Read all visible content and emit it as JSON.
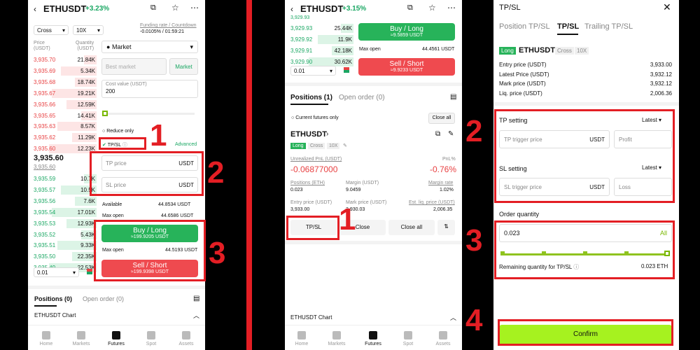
{
  "panel1": {
    "pair": "ETHUSDT",
    "change": "+3.23%",
    "margin_mode": "Cross",
    "leverage": "10X",
    "funding_label": "Funding rate / Countdown",
    "funding_value": "-0.0105% / 01:59:21",
    "col_price": "Price\n(USDT)",
    "col_qty": "Quantity\n(USDT)",
    "asks": [
      [
        "3,935.70",
        "21.84K"
      ],
      [
        "3,935.69",
        "5.34K"
      ],
      [
        "3,935.68",
        "18.74K"
      ],
      [
        "3,935.67",
        "19.21K"
      ],
      [
        "3,935.66",
        "12.59K"
      ],
      [
        "3,935.65",
        "14.41K"
      ],
      [
        "3,935.63",
        "8.57K"
      ],
      [
        "3,935.62",
        "11.29K"
      ],
      [
        "3,935.60",
        "12.23K"
      ]
    ],
    "last_price": "3,935.60",
    "mark_price": "3,935.60",
    "bids": [
      [
        "3,935.59",
        "10.7K"
      ],
      [
        "3,935.57",
        "10.5K"
      ],
      [
        "3,935.56",
        "7.6K"
      ],
      [
        "3,935.54",
        "17.01K"
      ],
      [
        "3,935.53",
        "12.93K"
      ],
      [
        "3,935.52",
        "5.43K"
      ],
      [
        "3,935.51",
        "9.33K"
      ],
      [
        "3,935.50",
        "22.35K"
      ],
      [
        "3,935.49",
        "22.53K"
      ]
    ],
    "precision": "0.01",
    "order_type": "Market",
    "best_market_placeholder": "Best market",
    "market_btn": "Market",
    "cost_label": "Cost value (USDT)",
    "cost_value": "200",
    "reduce_only": "Reduce only",
    "tpsl": "TP/SL",
    "advanced": "Advanced",
    "tp_placeholder": "TP price",
    "sl_placeholder": "SL price",
    "unit": "USDT",
    "available_label": "Available",
    "available_value": "44.8534 USDT",
    "max_open_label": "Max open",
    "max_open_long": "44.6586 USDT",
    "max_open_short": "44.5193 USDT",
    "buy_label": "Buy / Long",
    "buy_sub": "≈199.9205 USDT",
    "sell_label": "Sell / Short",
    "sell_sub": "≈199.9398 USDT",
    "tab_positions": "Positions (0)",
    "tab_orders": "Open order (0)",
    "chart_label": "ETHUSDT Chart",
    "nav": [
      "Home",
      "Markets",
      "Futures",
      "Spot",
      "Assets"
    ]
  },
  "panel2": {
    "pair": "ETHUSDT",
    "change": "+3.15%",
    "bids": [
      [
        "3,929.93",
        "25.44K"
      ],
      [
        "3,929.92",
        "11.9K"
      ],
      [
        "3,929.91",
        "42.18K"
      ],
      [
        "3,929.90",
        "30.62K"
      ]
    ],
    "top_bid": "3,929.93",
    "precision": "0.01",
    "buy_label": "Buy / Long",
    "buy_sub": "≈9.5859 USDT",
    "max_open_label": "Max open",
    "max_open_value": "44.4561 USDT",
    "sell_label": "Sell / Short",
    "sell_sub": "≈9.9233 USDT",
    "tab_positions": "Positions (1)",
    "tab_orders": "Open order (0)",
    "current_only": "Current futures only",
    "close_all_small": "Close all",
    "pos_pair": "ETHUSDT",
    "tag_long": "Long",
    "tag_cross": "Cross",
    "tag_lev": "10X",
    "upnl_label": "Unrealized PnL (USDT)",
    "upnl_value": "-0.06877000",
    "pnl_pct_label": "PnL%",
    "pnl_pct_value": "-0.76%",
    "positions_label": "Positions (ETH)",
    "positions_value": "0.023",
    "margin_label": "Margin (USDT)",
    "margin_value": "9.0459",
    "margin_rate_label": "Margin rate",
    "margin_rate_value": "1.02%",
    "entry_label": "Entry price (USDT)",
    "entry_value": "3,933.00",
    "mark_label": "Mark price (USDT)",
    "mark_value": "3,930.03",
    "liq_label": "Est. liq. price (USDT)",
    "liq_value": "2,006.35",
    "btn_tpsl": "TP/SL",
    "btn_close": "Close",
    "btn_close_all": "Close all",
    "chart_label": "ETHUSDT Chart",
    "nav": [
      "Home",
      "Markets",
      "Futures",
      "Spot",
      "Assets"
    ]
  },
  "panel3": {
    "title": "TP/SL",
    "tabs": [
      "Position TP/SL",
      "TP/SL",
      "Trailing TP/SL"
    ],
    "pair": "ETHUSDT",
    "tag_long": "Long",
    "tag_cross": "Cross",
    "tag_lev": "10X",
    "rows": [
      [
        "Entry price (USDT)",
        "3,933.00"
      ],
      [
        "Latest Price (USDT)",
        "3,932.12"
      ],
      [
        "Mark price (USDT)",
        "3,932.12"
      ],
      [
        "Liq. price (USDT)",
        "2,006.36"
      ]
    ],
    "tp_setting": "TP setting",
    "latest": "Latest",
    "tp_trigger_placeholder": "TP trigger price",
    "unit": "USDT",
    "profit_placeholder": "Profit",
    "sl_setting": "SL setting",
    "sl_trigger_placeholder": "SL trigger price",
    "loss_placeholder": "Loss",
    "order_qty": "Order quantity",
    "qty_value": "0.023",
    "all": "All",
    "remaining_label": "Remaining quantity for TP/SL",
    "remaining_value": "0.023 ETH",
    "slider_level": 1.0,
    "confirm": "Confirm"
  },
  "steps": {
    "p1": [
      "1",
      "2",
      "3"
    ],
    "p2": [
      "1"
    ],
    "p3": [
      "2",
      "3",
      "4"
    ]
  },
  "colors": {
    "accent_red": "#e31e24",
    "buy_green": "#27b35a",
    "sell_red": "#ef4a4f",
    "confirm_lime": "#a6f21f"
  }
}
